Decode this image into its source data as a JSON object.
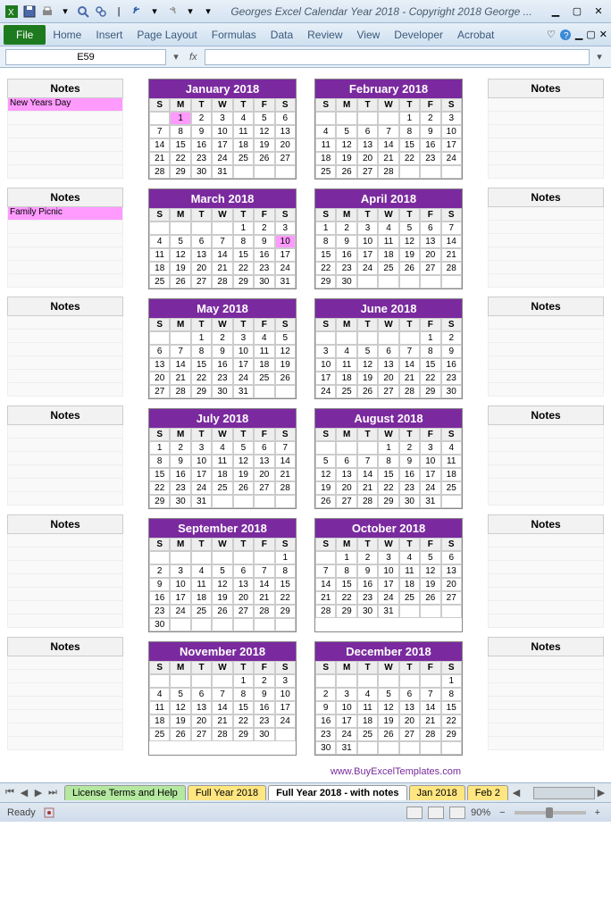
{
  "titlebar": {
    "title": "Georges Excel Calendar Year 2018 -  Copyright 2018 George ..."
  },
  "ribbon": {
    "file": "File",
    "tabs": [
      "Home",
      "Insert",
      "Page Layout",
      "Formulas",
      "Data",
      "Review",
      "View",
      "Developer",
      "Acrobat"
    ]
  },
  "formulabar": {
    "namebox": "E59",
    "fx": "fx",
    "formula": ""
  },
  "notes": {
    "left_header": "Notes",
    "right_header": "Notes",
    "left_items": [
      {
        "row": 0,
        "block": 0,
        "text": "New Years Day",
        "hl": true
      },
      {
        "row": 0,
        "block": 1,
        "text": "Family Picnic",
        "hl": true
      }
    ]
  },
  "dow": [
    "S",
    "M",
    "T",
    "W",
    "T",
    "F",
    "S"
  ],
  "months": [
    {
      "name": "January 2018",
      "start": 1,
      "days": 31,
      "hl": [
        1
      ]
    },
    {
      "name": "February 2018",
      "start": 4,
      "days": 28,
      "hl": []
    },
    {
      "name": "March 2018",
      "start": 4,
      "days": 31,
      "hl": [
        10
      ]
    },
    {
      "name": "April 2018",
      "start": 0,
      "days": 30,
      "hl": []
    },
    {
      "name": "May 2018",
      "start": 2,
      "days": 31,
      "hl": []
    },
    {
      "name": "June 2018",
      "start": 5,
      "days": 30,
      "hl": []
    },
    {
      "name": "July 2018",
      "start": 0,
      "days": 31,
      "hl": []
    },
    {
      "name": "August 2018",
      "start": 3,
      "days": 31,
      "hl": []
    },
    {
      "name": "September 2018",
      "start": 6,
      "days": 30,
      "hl": []
    },
    {
      "name": "October 2018",
      "start": 1,
      "days": 31,
      "hl": []
    },
    {
      "name": "November 2018",
      "start": 4,
      "days": 30,
      "hl": []
    },
    {
      "name": "December 2018",
      "start": 6,
      "days": 31,
      "hl": []
    }
  ],
  "footer_link": "www.BuyExcelTemplates.com",
  "sheet_tabs": {
    "t1": "License Terms and Help",
    "t2": "Full Year 2018",
    "t3": "Full Year 2018 - with notes",
    "t4": "Jan 2018",
    "t5": "Feb 2"
  },
  "statusbar": {
    "ready": "Ready",
    "zoom": "90%",
    "minus": "−",
    "plus": "+"
  }
}
